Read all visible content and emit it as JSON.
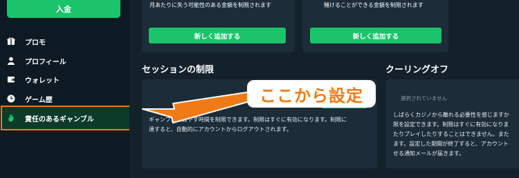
{
  "sidebar": {
    "deposit_label": "入金",
    "items": [
      {
        "label": "プロモ",
        "icon": "gift-icon"
      },
      {
        "label": "プロフィール",
        "icon": "user-icon"
      },
      {
        "label": "ウォレット",
        "icon": "wallet-icon"
      },
      {
        "label": "ゲーム歴",
        "icon": "clock-icon"
      },
      {
        "label": "責任のあるギャンブル",
        "icon": "hand-icon"
      }
    ]
  },
  "top_cards": [
    {
      "text": "月あたりに失う可能性のある金額を制限されます",
      "button_label": "新しく追加する"
    },
    {
      "text": "賭けることができる金額を制限されます",
      "button_label": "新しく追加する"
    }
  ],
  "session_limit": {
    "title": "セッションの制限",
    "description_line1": "ギャンブルに費やす時間を制限できます。制限はすぐに有効になります。制限に",
    "description_line2": "達すると、自動的にアカウントからログアウトされます。"
  },
  "cooling_off": {
    "title": "クーリングオフ",
    "placeholder": "選択されていません",
    "description_line1": "しばらくカジノから離れる必要性を感じますか",
    "description_line2": "限を設定できます。制限はすぐに有効になりま",
    "description_line3": "たりプレイしたりすることはできません。また",
    "description_line4": "ます。設定した期間が終了すると、アカウント",
    "description_line5": "せる通知メールが届きます。"
  },
  "annotation": {
    "callout_text": "ここから設定",
    "accent_color": "#f07b16"
  },
  "colors": {
    "accent_green": "#1bc46b",
    "sidebar_bg": "#0d1a23",
    "card_bg": "#1c2c38"
  }
}
